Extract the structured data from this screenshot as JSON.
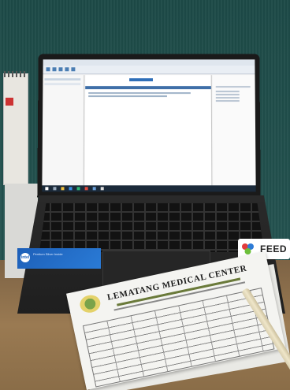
{
  "scene": {
    "paper_header": {
      "title": "LEMATANG MEDICAL CENTER"
    },
    "sticker_intel": {
      "logo_text": "intel",
      "text": "Pentium Silver Inside"
    },
    "sticker_feed": {
      "text": "FEED"
    }
  },
  "colors": {
    "wall": "#1f4f4c",
    "desk": "#8b6a44",
    "screen": "#f2f2f2",
    "intel_blue": "#1d5fb8"
  }
}
